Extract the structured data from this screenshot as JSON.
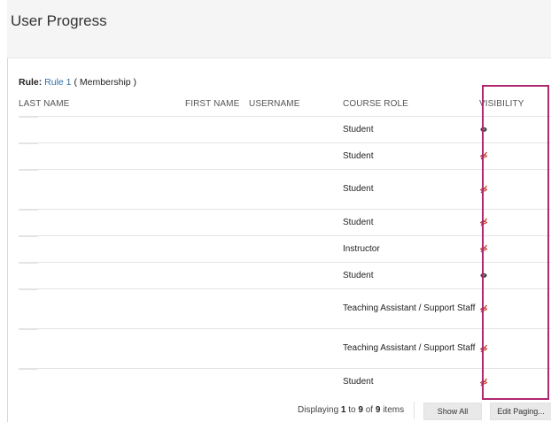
{
  "page": {
    "title": "User Progress"
  },
  "rule": {
    "label": "Rule:",
    "link_text": "Rule 1",
    "type_text": " ( Membership )"
  },
  "table": {
    "headers": {
      "last_name": "LAST NAME",
      "first_name": "FIRST NAME",
      "username": "USERNAME",
      "course_role": "COURSE ROLE",
      "visibility": "VISIBILITY"
    },
    "rows": [
      {
        "course_role": "Student",
        "visibility": "visible"
      },
      {
        "course_role": "Student",
        "visibility": "hidden"
      },
      {
        "course_role": "Student",
        "visibility": "hidden"
      },
      {
        "course_role": "Student",
        "visibility": "hidden"
      },
      {
        "course_role": "Instructor",
        "visibility": "hidden"
      },
      {
        "course_role": "Student",
        "visibility": "visible"
      },
      {
        "course_role": "Teaching Assistant / Support Staff",
        "visibility": "hidden"
      },
      {
        "course_role": "Teaching Assistant / Support Staff",
        "visibility": "hidden"
      },
      {
        "course_role": "Student",
        "visibility": "hidden"
      }
    ]
  },
  "icons": {
    "visible": "eye-icon",
    "hidden": "eye-slash-icon"
  },
  "colors": {
    "link": "#2f6fae",
    "highlight": "#b0286f",
    "hidden_icon": "#c0392b"
  },
  "pagination": {
    "prefix": "Displaying ",
    "from": "1",
    "to_word": " to ",
    "to": "9",
    "of_word": " of ",
    "total": "9",
    "suffix": " items",
    "show_all_label": "Show All",
    "edit_paging_label": "Edit Paging..."
  }
}
